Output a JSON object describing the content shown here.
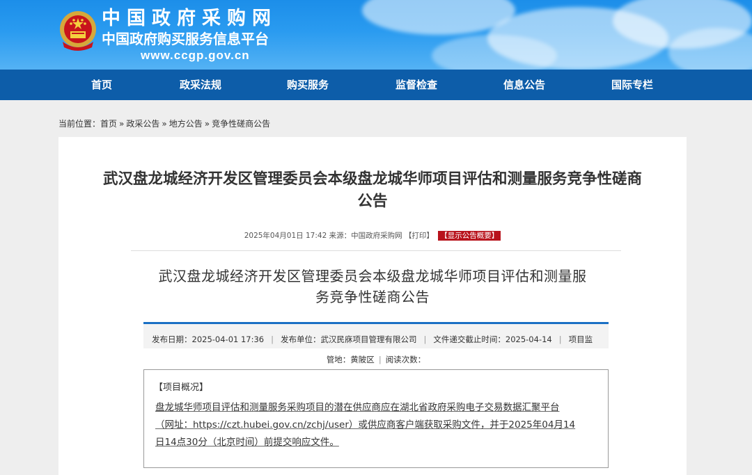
{
  "site": {
    "name": "中国政府采购网",
    "subname": "中国政府购买服务信息平台",
    "url": "www.ccgp.gov.cn"
  },
  "nav": {
    "items": [
      {
        "label": "首页"
      },
      {
        "label": "政采法规"
      },
      {
        "label": "购买服务"
      },
      {
        "label": "监督检查"
      },
      {
        "label": "信息公告"
      },
      {
        "label": "国际专栏"
      }
    ]
  },
  "breadcrumb": {
    "prefix": "当前位置：",
    "items": [
      "首页",
      "政采公告",
      "地方公告",
      "竞争性磋商公告"
    ],
    "separator": "»"
  },
  "article": {
    "title_line1": "武汉盘龙城经济开发区管理委员会本级盘龙城华师项目评估和测量服务竞争性磋商",
    "title_line2": "公告",
    "meta_text": "2025年04月01日 17:42 来源：中国政府采购网",
    "print_label": "【打印】",
    "summary_badge": "【显示公告概要】",
    "sub_title_line1": "武汉盘龙城经济开发区管理委员会本级盘龙城华师项目评估和测量服",
    "sub_title_line2": "务竞争性磋商公告",
    "info": {
      "publish_date": "发布日期：2025-04-01 17:36",
      "publisher": "发布单位：武汉民庥项目管理有限公司",
      "deadline": "文件递交截止时间：2025-04-14",
      "supervision_prefix": "项目监",
      "supervision_rest": "管地：黄陂区",
      "views": "阅读次数："
    },
    "summary": {
      "heading": "【项目概况】",
      "line1": "盘龙城华师项目评估和测量服务采购项目的潜在供应商应在湖北省政府采购电子交易数据汇聚平台",
      "line2": "（网址：https://czt.hubei.gov.cn/zchj/user）或供应商客户端获取采购文件，并于2025年04月14",
      "line3": "日14点30分（北京时间）前提交响应文件。"
    }
  },
  "colors": {
    "header_blue": "#1c8ee9",
    "nav_blue": "#0d5da9",
    "badge_red": "#b8131c",
    "info_border": "#1a6fc4"
  }
}
